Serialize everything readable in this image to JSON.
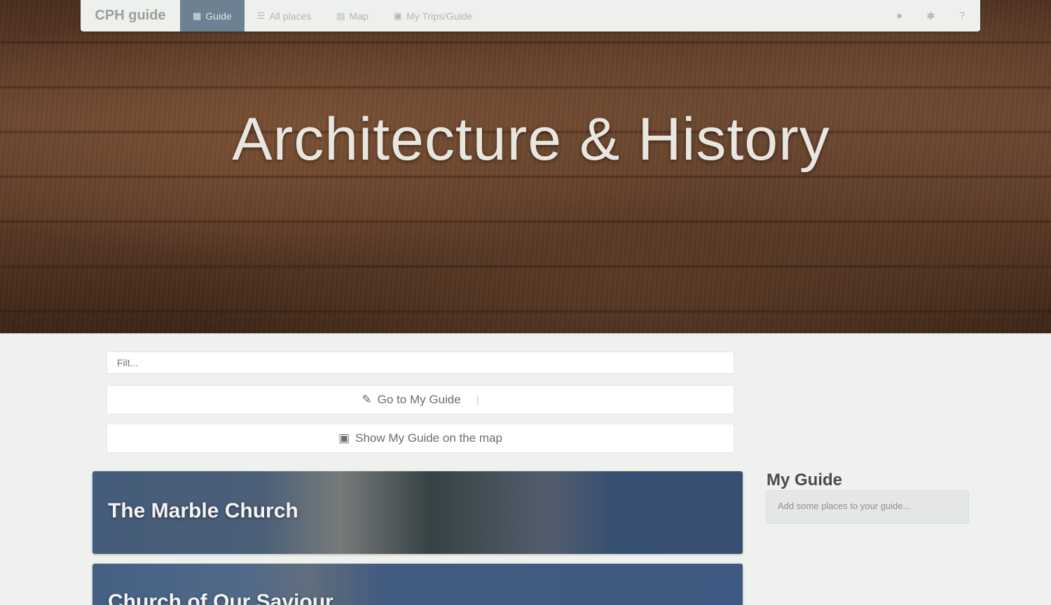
{
  "navbar": {
    "brand": "CPH guide",
    "items": [
      {
        "label": "Guide",
        "icon": "grid-icon",
        "active": true
      },
      {
        "label": "All places",
        "icon": "list-icon",
        "active": false
      },
      {
        "label": "Map",
        "icon": "map-icon",
        "active": false
      },
      {
        "label": "My Trips/Guide",
        "icon": "bookmark-icon",
        "active": false
      }
    ],
    "right_icons": [
      "user-icon",
      "settings-icon",
      "help-icon"
    ]
  },
  "hero": {
    "title": "Architecture & History"
  },
  "search": {
    "placeholder": "Filt..."
  },
  "buttons": {
    "go_to_guide": "Go to My Guide",
    "show_on_map": "Show My Guide on the map"
  },
  "cards": [
    {
      "title": "The Marble Church"
    },
    {
      "title": "Church of Our Saviour"
    }
  ],
  "sidebar": {
    "title": "My Guide",
    "empty_text": "Add some places to your guide..."
  },
  "colors": {
    "nav_active": "#6d8192",
    "page_bg": "#eef1ee",
    "card_blue": "#3d5579"
  }
}
